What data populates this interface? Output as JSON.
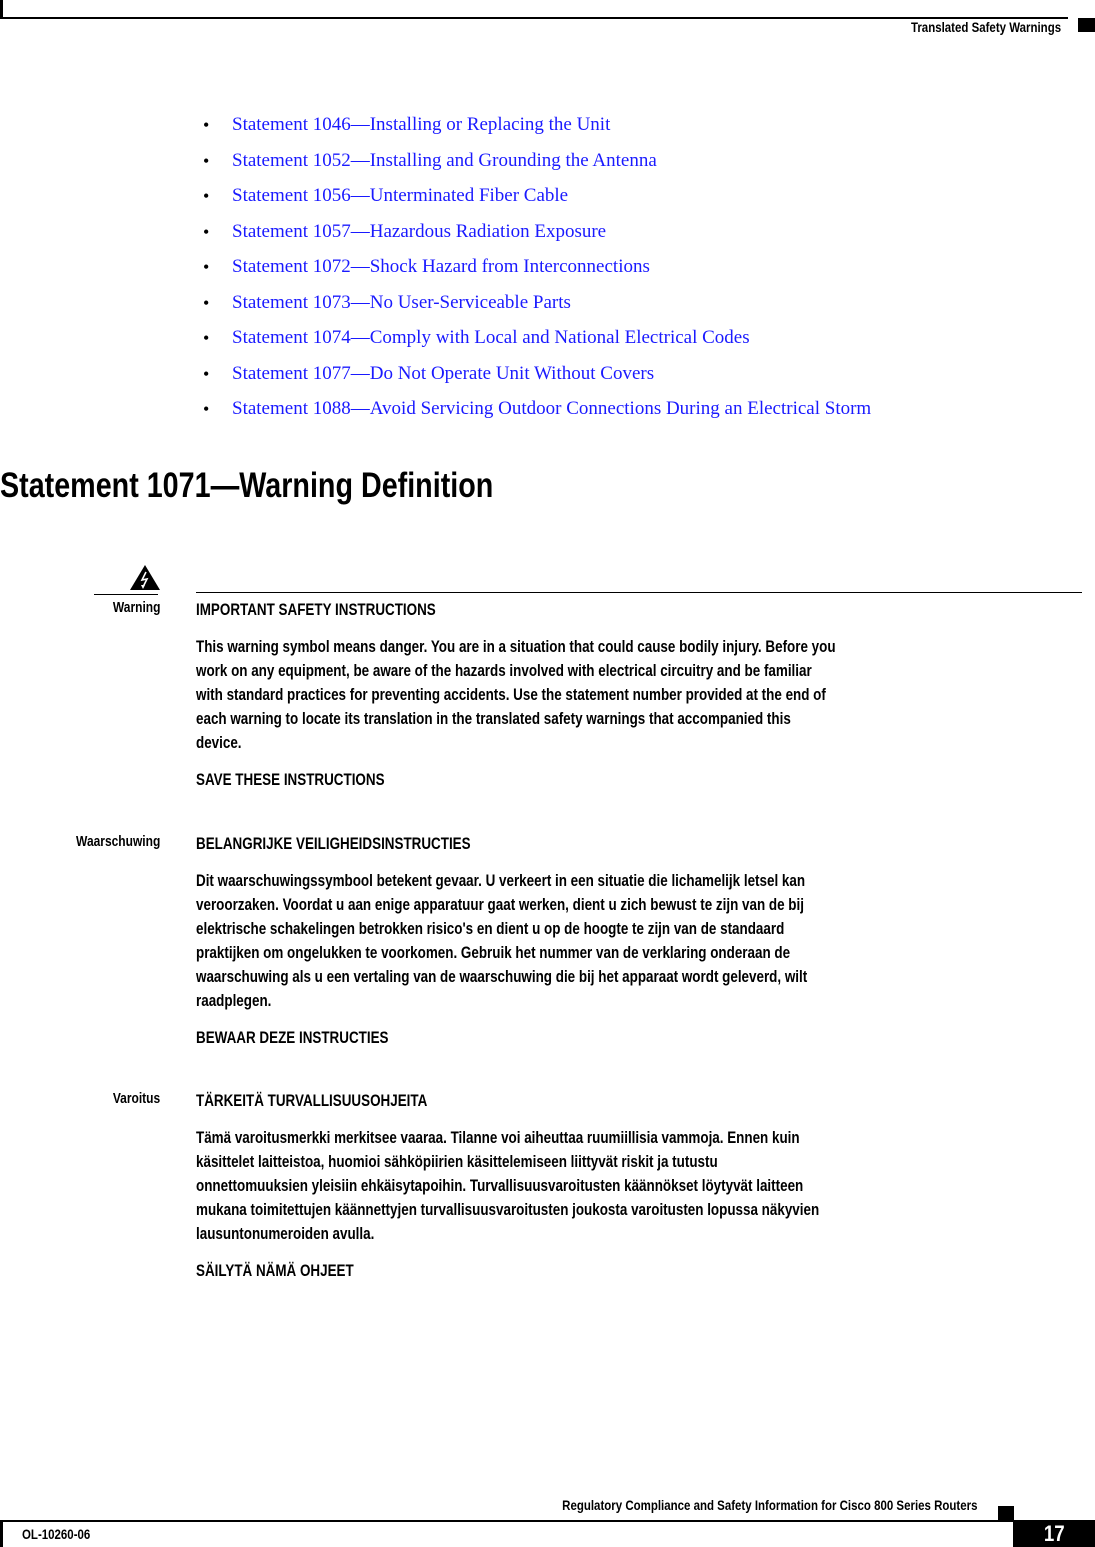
{
  "header": {
    "section_title": "Translated Safety Warnings"
  },
  "statement_links": [
    {
      "label": "Statement 1046—Installing or Replacing the Unit"
    },
    {
      "label": "Statement 1052—Installing and Grounding the Antenna"
    },
    {
      "label": "Statement 1056—Unterminated Fiber Cable"
    },
    {
      "label": "Statement 1057—Hazardous Radiation Exposure"
    },
    {
      "label": "Statement 1072—Shock Hazard from Interconnections"
    },
    {
      "label": "Statement 1073—No User-Serviceable Parts"
    },
    {
      "label": "Statement 1074—Comply with Local and National Electrical Codes"
    },
    {
      "label": "Statement 1077—Do Not Operate Unit Without Covers"
    },
    {
      "label": "Statement 1088—Avoid Servicing Outdoor Connections During an Electrical Storm"
    }
  ],
  "section": {
    "title": "Statement 1071—Warning Definition",
    "icon": "warning-triangle-lightning-icon",
    "link_color": "#1a1aff"
  },
  "warnings": [
    {
      "label": "Warning",
      "heading": "IMPORTANT SAFETY INSTRUCTIONS",
      "lines": [
        "This warning symbol means danger. You are in a situation that could cause bodily injury. Before you",
        "work on any equipment, be aware of the hazards involved with electrical circuitry and be familiar",
        "with standard practices for preventing accidents. Use the statement number provided at the end of",
        "each warning to locate its translation in the translated safety warnings that accompanied this",
        "device."
      ],
      "save": "SAVE THESE INSTRUCTIONS"
    },
    {
      "label": "Waarschuwing",
      "heading": "BELANGRIJKE VEILIGHEIDSINSTRUCTIES",
      "lines": [
        "Dit waarschuwingssymbool betekent gevaar. U verkeert in een situatie die lichamelijk letsel kan",
        "veroorzaken. Voordat u aan enige apparatuur gaat werken, dient u zich bewust te zijn van de bij",
        "elektrische schakelingen betrokken risico's en dient u op de hoogte te zijn van de standaard",
        "praktijken om ongelukken te voorkomen. Gebruik het nummer van de verklaring onderaan de",
        "waarschuwing als u een vertaling van de waarschuwing die bij het apparaat wordt geleverd, wilt",
        "raadplegen."
      ],
      "save": "BEWAAR DEZE INSTRUCTIES"
    },
    {
      "label": "Varoitus",
      "heading": "TÄRKEITÄ TURVALLISUUSOHJEITA",
      "lines": [
        "Tämä varoitusmerkki merkitsee vaaraa. Tilanne voi aiheuttaa ruumiillisia vammoja. Ennen kuin",
        "käsittelet laitteistoa, huomioi sähköpiirien käsittelemiseen liittyvät riskit ja tutustu",
        "onnettomuuksien yleisiin ehkäisytapoihin. Turvallisuusvaroitusten käännökset löytyvät laitteen",
        "mukana toimitettujen käännettyjen turvallisuusvaroitusten joukosta varoitusten lopussa näkyvien",
        "lausuntonumeroiden avulla."
      ],
      "save": "SÄILYTÄ NÄMÄ OHJEET"
    }
  ],
  "footer": {
    "doc_title": "Regulatory Compliance and Safety Information for Cisco 800 Series Routers",
    "doc_number": "OL-10260-06",
    "page_number": "17"
  }
}
